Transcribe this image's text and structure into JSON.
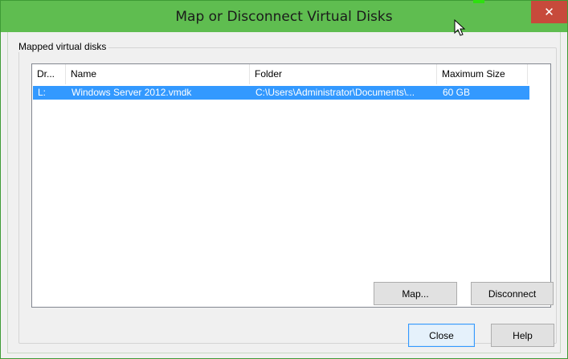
{
  "window": {
    "title": "Map or Disconnect Virtual Disks",
    "close_glyph": "✕"
  },
  "group": {
    "label": "Mapped virtual disks"
  },
  "list": {
    "columns": [
      "Dr...",
      "Name",
      "Folder",
      "Maximum Size"
    ],
    "rows": [
      {
        "drive": "L:",
        "name": "Windows Server 2012.vmdk",
        "folder": "C:\\Users\\Administrator\\Documents\\...",
        "max_size": "60 GB",
        "selected": true
      }
    ]
  },
  "buttons": {
    "map": "Map...",
    "disconnect": "Disconnect",
    "close": "Close",
    "help": "Help"
  },
  "colors": {
    "titlebar": "#5fbd50",
    "selection": "#3399ff",
    "close_button": "#c74a3b"
  }
}
